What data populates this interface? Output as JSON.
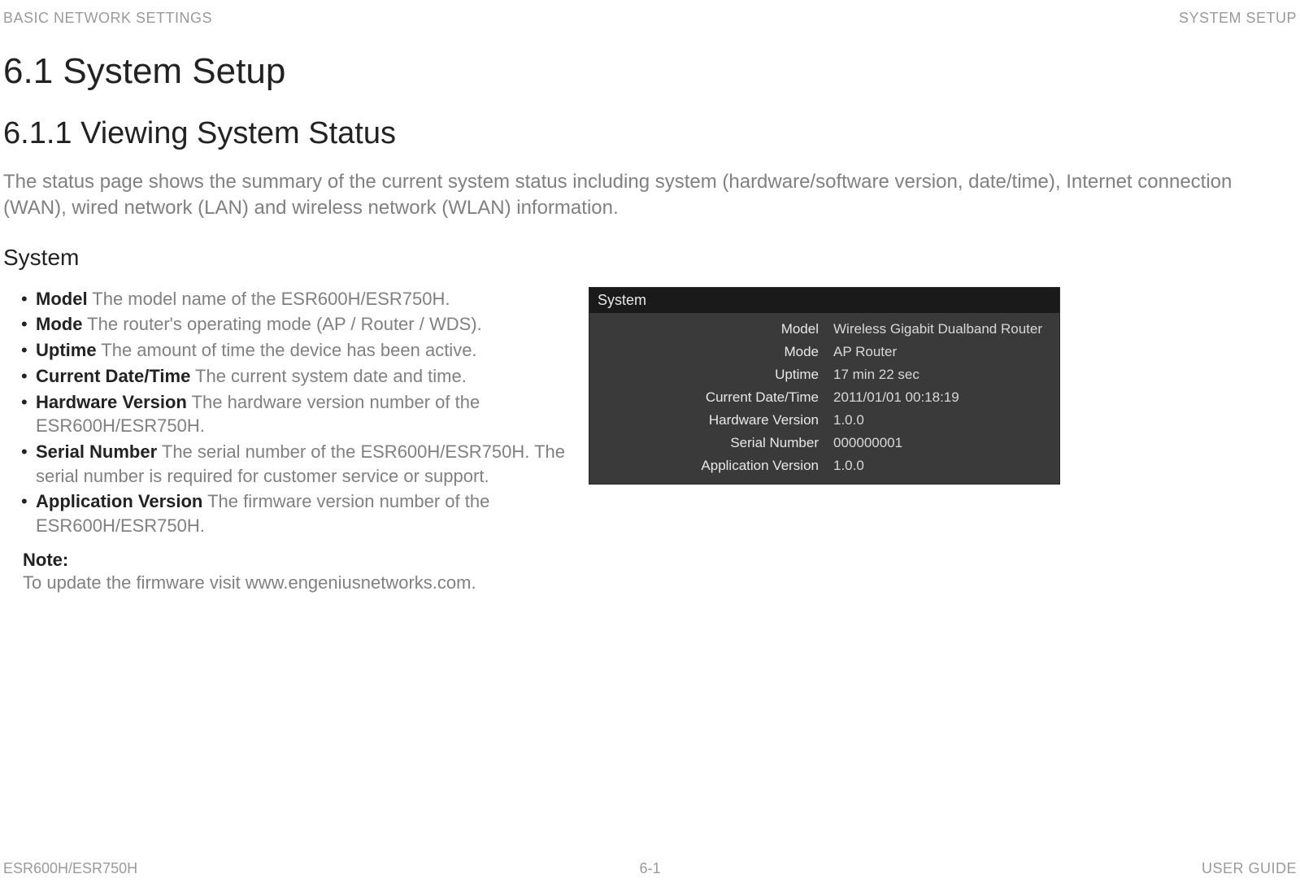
{
  "header": {
    "left": "BASIC NETWORK SETTINGS",
    "right": "SYSTEM SETUP"
  },
  "section": {
    "title": "6.1 System Setup",
    "subsection_title": "6.1.1 Viewing System Status",
    "intro": "The status page shows the summary of the current system status including system (hardware/software version, date/time), Internet connection (WAN), wired network (LAN) and wireless network (WLAN) information.",
    "subheading": "System"
  },
  "bullets": [
    {
      "term": "Model",
      "desc": "  The model name of the ESR600H/ESR750H."
    },
    {
      "term": "Mode",
      "desc": "  The router's operating mode (AP / Router / WDS)."
    },
    {
      "term": "Uptime",
      "desc": "  The amount of time the device has been active."
    },
    {
      "term": "Current Date/Time",
      "desc": "  The current system date and time."
    },
    {
      "term": "Hardware Version",
      "desc": "  The hardware version number of the ESR600H/ESR750H."
    },
    {
      "term": "Serial Number",
      "desc": "  The serial number of the ESR600H/ESR750H. The serial number is required for customer service or support."
    },
    {
      "term": "Application Version",
      "desc": "  The firmware version number of the ESR600H/ESR750H."
    }
  ],
  "note": {
    "label": "Note:",
    "text": "To update the firmware visit www.engeniusnetworks.com."
  },
  "screenshot": {
    "title": "System",
    "rows": [
      {
        "label": "Model",
        "value": "Wireless Gigabit Dualband Router"
      },
      {
        "label": "Mode",
        "value": "AP Router"
      },
      {
        "label": "Uptime",
        "value": "17 min 22 sec"
      },
      {
        "label": "Current Date/Time",
        "value": "2011/01/01 00:18:19"
      },
      {
        "label": "Hardware Version",
        "value": "1.0.0"
      },
      {
        "label": "Serial Number",
        "value": "000000001"
      },
      {
        "label": "Application Version",
        "value": "1.0.0"
      }
    ]
  },
  "footer": {
    "left": "ESR600H/ESR750H",
    "center": "6-1",
    "right": "USER GUIDE"
  }
}
